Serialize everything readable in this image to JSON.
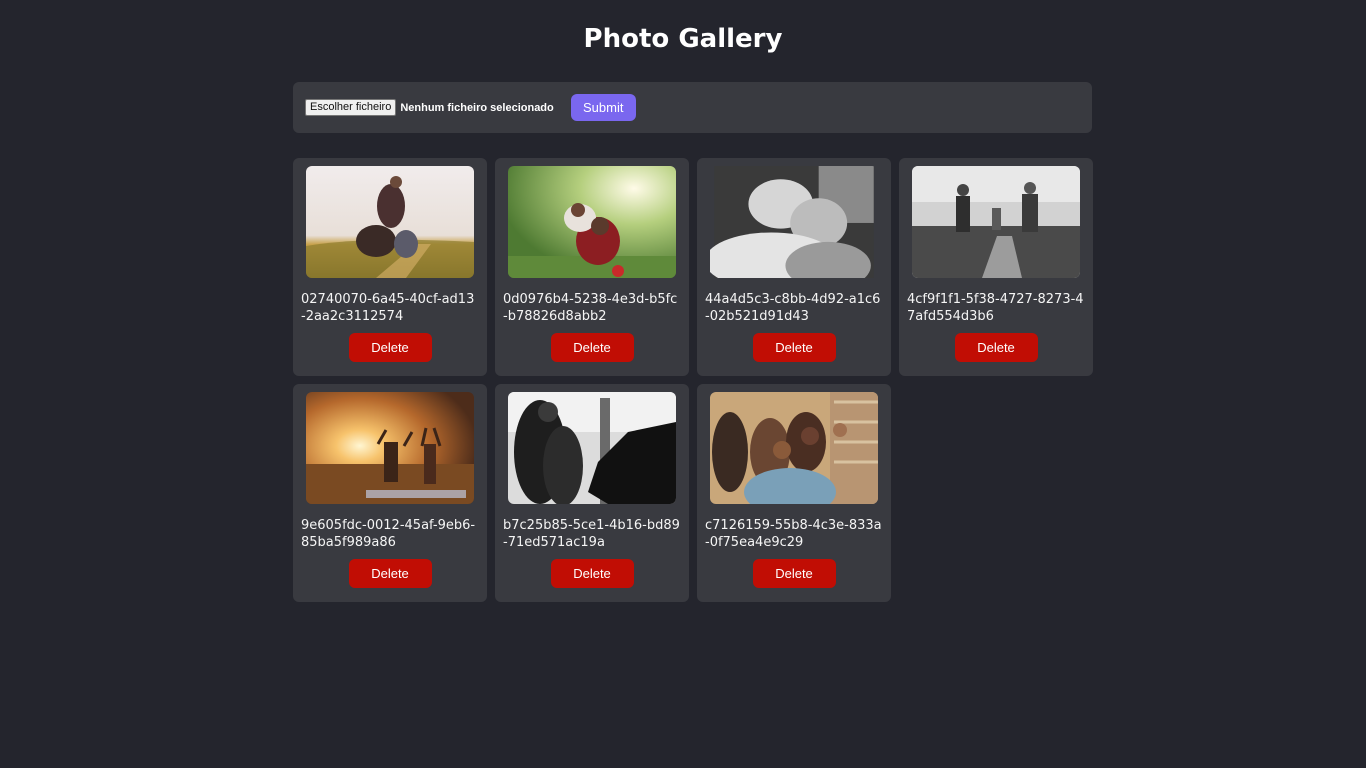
{
  "header": {
    "title": "Photo Gallery"
  },
  "upload": {
    "choose_file_label": "Escolher ficheiro",
    "file_status": "Nenhum ficheiro selecionado",
    "submit_label": "Submit"
  },
  "gallery": {
    "delete_label": "Delete",
    "photos": [
      {
        "name": "02740070-6a45-40cf-ad13-2aa2c3112574",
        "scene": "family-field-sunset"
      },
      {
        "name": "0d0976b4-5238-4e3d-b5fc-b78826d8abb2",
        "scene": "piggyback-park"
      },
      {
        "name": "44a4d5c3-c8bb-4d92-a1c6-02b521d91d43",
        "scene": "elderly-couple-bw"
      },
      {
        "name": "4cf9f1f1-5f38-4727-8273-47afd554d3b6",
        "scene": "family-walk-bw"
      },
      {
        "name": "9e605fdc-0012-45af-9eb6-85ba5f989a86",
        "scene": "friends-sunset-hands-up"
      },
      {
        "name": "b7c25b85-5ce1-4b16-bd89-71ed571ac19a",
        "scene": "couple-with-horse-bw"
      },
      {
        "name": "c7126159-55b8-4c3e-833a-0f75ea4e9c29",
        "scene": "group-selfie"
      }
    ]
  }
}
